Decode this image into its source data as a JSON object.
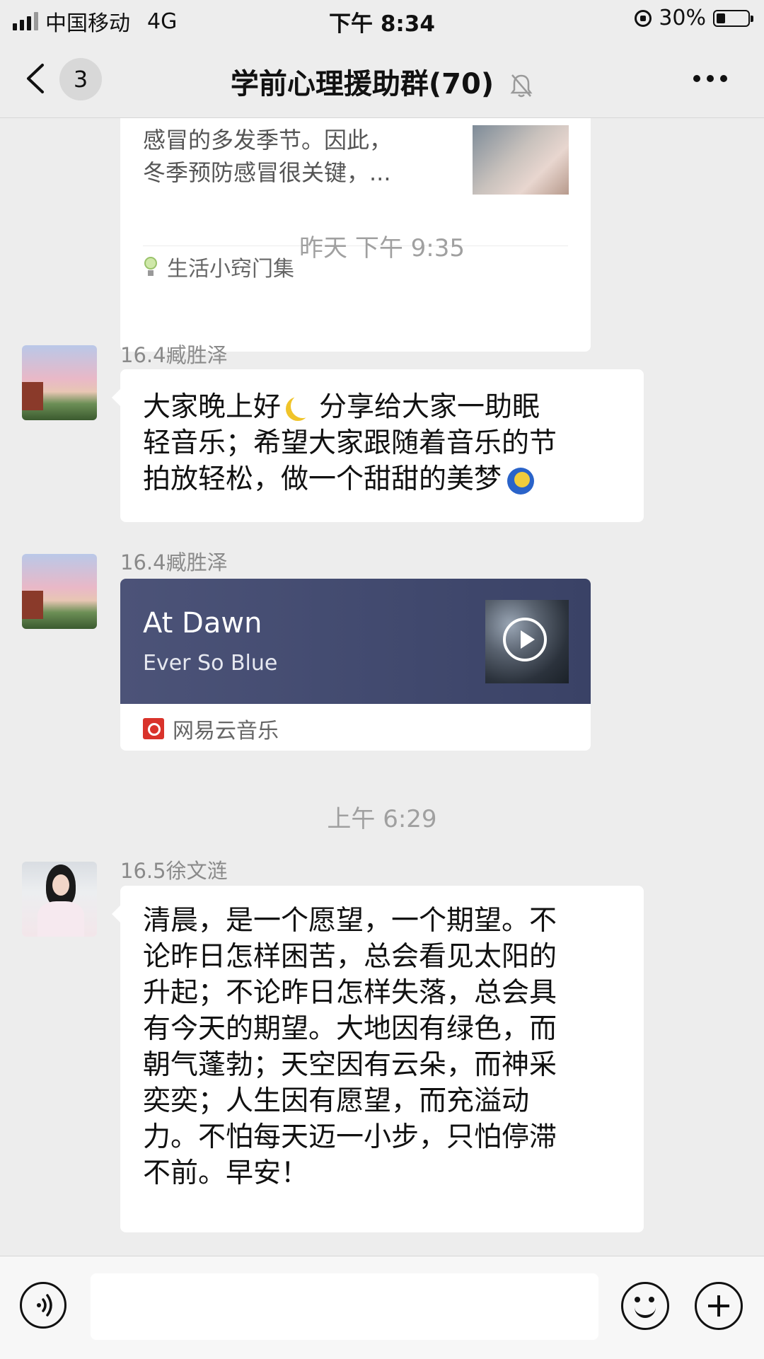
{
  "status_bar": {
    "carrier": "中国移动",
    "network": "4G",
    "time": "下午 8:34",
    "battery": "30%"
  },
  "nav": {
    "unread_count": "3",
    "title": "学前心理援助群(70)",
    "icons": [
      "back-icon",
      "mute-bell-icon",
      "more-icon"
    ]
  },
  "chat": {
    "link_card": {
      "snippet_line1": "感冒的多发季节。因此，",
      "snippet_line2": "冬季预防感冒很关键，...",
      "source": "生活小窍门集"
    },
    "timestamp1": "昨天 下午 9:35",
    "msg1": {
      "sender": "16.4臧胜泽",
      "line1_a": "大家晚上好",
      "line1_b": "分享给大家一助眠",
      "line2": "轻音乐；希望大家跟随着音乐的节",
      "line3": "拍放轻松，做一个甜甜的美梦"
    },
    "msg2": {
      "sender": "16.4臧胜泽",
      "music_title": "At Dawn",
      "music_artist": "Ever So Blue",
      "source": "网易云音乐"
    },
    "timestamp2": "上午 6:29",
    "msg3": {
      "sender": "16.5徐文涟",
      "lines": [
        "清晨，是一个愿望，一个期望。不",
        "论昨日怎样困苦，总会看见太阳的",
        "升起；不论昨日怎样失落，总会具",
        "有今天的期望。大地因有绿色，而",
        "朝气蓬勃；天空因有云朵，而神采",
        "奕奕；人生因有愿望，而充溢动",
        "力。不怕每天迈一小步，只怕停滞",
        "不前。早安！"
      ]
    }
  },
  "input_bar": {
    "icons": [
      "voice-icon",
      "emoji-icon",
      "plus-icon"
    ]
  }
}
